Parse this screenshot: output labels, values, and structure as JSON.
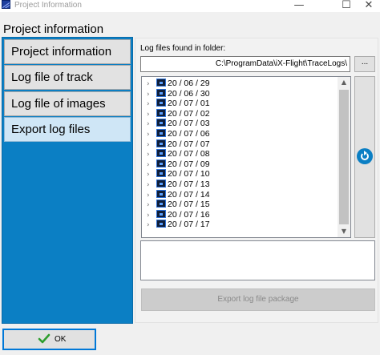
{
  "window": {
    "title": "Project Information",
    "minimize_glyph": "—",
    "maximize_glyph": "☐",
    "close_glyph": "✕"
  },
  "heading": "Project information",
  "nav": {
    "items": [
      {
        "label": "Project information",
        "active": false
      },
      {
        "label": "Log file of track",
        "active": false
      },
      {
        "label": "Log file of images",
        "active": false
      },
      {
        "label": "Export log files",
        "active": true
      }
    ]
  },
  "folder": {
    "label": "Log files found in folder:",
    "path": "C:\\ProgramData\\iX-Flight\\TraceLogs\\",
    "browse_label": "..."
  },
  "tree": {
    "expander_icon": "chevron-right-icon",
    "item_icon": "calendar-icon",
    "items": [
      "20 / 06 / 29",
      "20 / 06 / 30",
      "20 / 07 / 01",
      "20 / 07 / 02",
      "20 / 07 / 03",
      "20 / 07 / 06",
      "20 / 07 / 07",
      "20 / 07 / 08",
      "20 / 07 / 09",
      "20 / 07 / 10",
      "20 / 07 / 13",
      "20 / 07 / 14",
      "20 / 07 / 15",
      "20 / 07 / 16",
      "20 / 07 / 17"
    ]
  },
  "export_button": {
    "label": "Export log file package",
    "enabled": false
  },
  "ok_button": {
    "label": "OK"
  },
  "colors": {
    "accent": "#0b7fc4",
    "nav_active": "#cfe6f6",
    "nav_item": "#e2e2e2",
    "focus_border": "#0078d7",
    "ok_check": "#2e9e2e"
  }
}
